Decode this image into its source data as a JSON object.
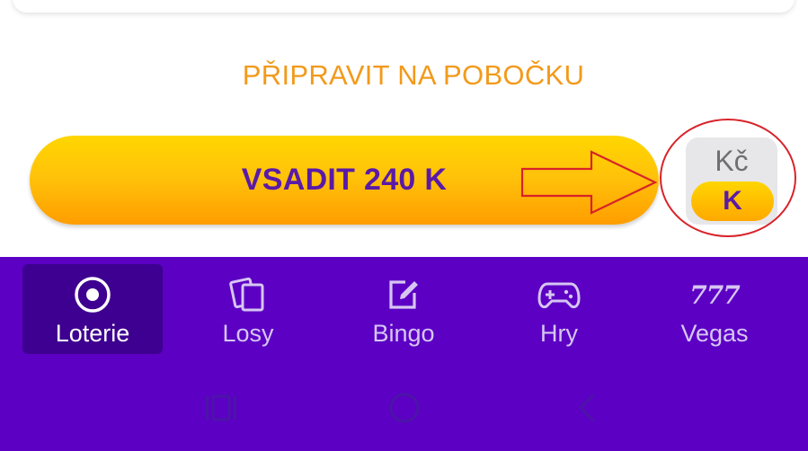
{
  "pickup_link": "PŘIPRAVIT NA POBOČKU",
  "bet_button": {
    "label": "VSADIT 240 K"
  },
  "currency_toggle": {
    "top_label": "Kč",
    "selected_label": "K"
  },
  "tabs": [
    {
      "label": "Loterie",
      "icon": "lottery-ball-icon",
      "active": true
    },
    {
      "label": "Losy",
      "icon": "scratch-cards-icon",
      "active": false
    },
    {
      "label": "Bingo",
      "icon": "bingo-edit-icon",
      "active": false
    },
    {
      "label": "Hry",
      "icon": "gamepad-icon",
      "active": false
    },
    {
      "label": "Vegas",
      "icon": "triple-seven-icon",
      "active": false,
      "icon_text": "777"
    }
  ],
  "system_nav": [
    "recent-apps-icon",
    "home-icon",
    "back-icon"
  ],
  "colors": {
    "accent_orange": "#f29a1b",
    "brand_purple": "#5c00c4",
    "active_tab": "#3e0090",
    "button_text": "#5a1aa8",
    "annotation_red": "#d8232a"
  }
}
